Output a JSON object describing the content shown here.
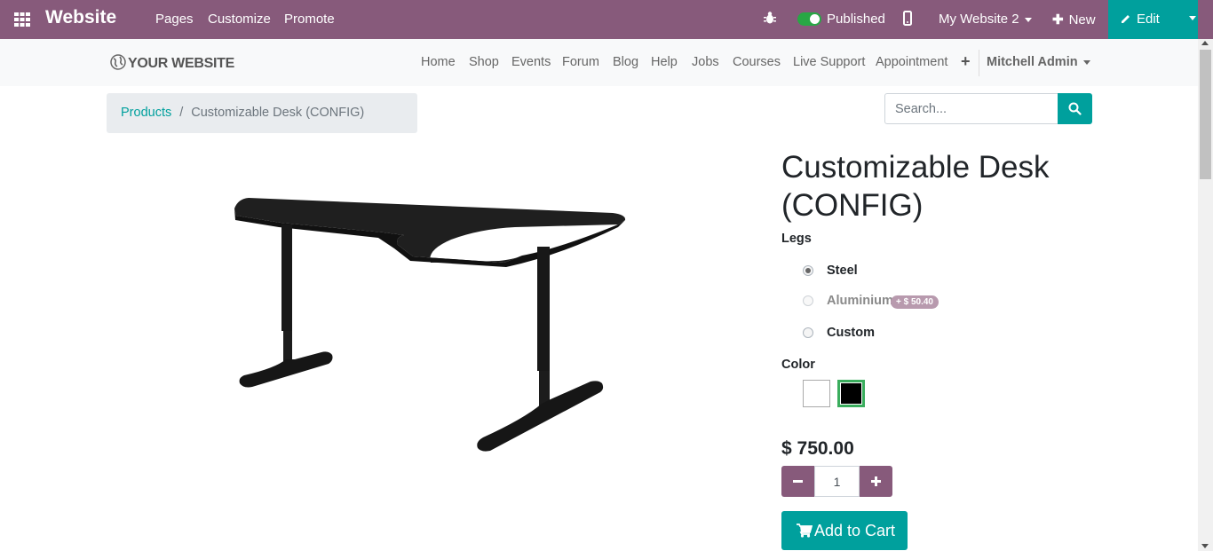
{
  "admin_bar": {
    "app_name": "Website",
    "menu": [
      "Pages",
      "Customize",
      "Promote"
    ],
    "published_label": "Published",
    "website_selector": "My Website 2",
    "new_label": "New",
    "edit_label": "Edit",
    "colors": {
      "background": "#875a7b",
      "edit": "#00a09d",
      "toggle_on": "#28a745"
    }
  },
  "navbar": {
    "logo_text": "YOUR WEBSITE",
    "links": [
      "Home",
      "Shop",
      "Events",
      "Forum",
      "Blog",
      "Help",
      "Jobs",
      "Courses",
      "Live Support",
      "Appointment"
    ],
    "add_symbol": "+",
    "user_name": "Mitchell Admin"
  },
  "breadcrumb": {
    "parent": "Products",
    "separator": "/",
    "current": "Customizable Desk (CONFIG)"
  },
  "search": {
    "placeholder": "Search..."
  },
  "product": {
    "title": "Customizable Desk (CONFIG)",
    "legs_label": "Legs",
    "legs_options": [
      {
        "label": "Steel",
        "checked": true
      },
      {
        "label": "Aluminium",
        "extra": "+ $ 50.40",
        "disabled": true
      },
      {
        "label": "Custom",
        "checked": false
      }
    ],
    "color_label": "Color",
    "colors": [
      {
        "name": "White",
        "hex": "#ffffff",
        "selected": false
      },
      {
        "name": "Black",
        "hex": "#000000",
        "selected": true
      }
    ],
    "price": "$ 750.00",
    "quantity": "1",
    "add_to_cart_label": "Add to Cart"
  }
}
